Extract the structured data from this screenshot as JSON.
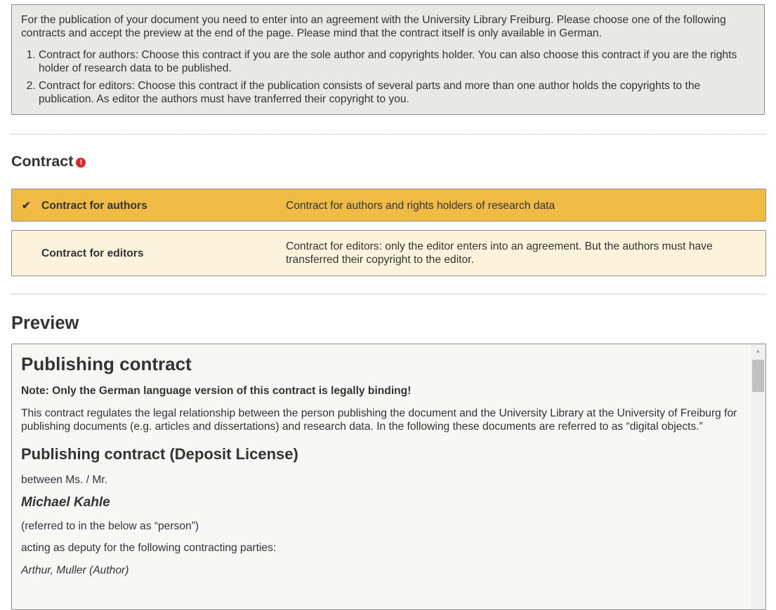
{
  "intro": {
    "text": "For the publication of your document you need to enter into an agreement with the University Library Freiburg. Please choose one of the following contracts and accept the preview at the end of the page. Please mind that the contract itself is only available in German.",
    "items": [
      "Contract for authors: Choose this contract if you are the sole author and copyrights holder. You can also choose this contract if you are the rights holder of research data to be published.",
      "Contract for editors: Choose this contract if the publication consists of several parts and more than one author holds the copyrights to the publication. As editor the authors must have tranferred their copyright to you."
    ]
  },
  "contract": {
    "heading": "Contract",
    "required_icon": "exclamation-icon",
    "options": [
      {
        "title": "Contract for authors",
        "description": "Contract for authors and rights holders of research data",
        "selected": true,
        "icon": "checkmark-icon",
        "color": "#f0bb44"
      },
      {
        "title": "Contract for editors",
        "description": "Contract for editors: only the editor enters into an agreement. But the authors must have transferred their copyright to the editor.",
        "selected": false,
        "color": "#fdf3dc"
      }
    ]
  },
  "preview": {
    "heading": "Preview",
    "doc": {
      "title": "Publishing contract",
      "note": "Note: Only the German language version of this contract is legally binding!",
      "intro": "This contract regulates the legal relationship between the person publishing the document and the University Library at the University of Freiburg for publishing documents (e.g. articles and dissertations) and research data. In the following these documents are referred to as “digital objects.”",
      "subtitle": "Publishing contract (Deposit License)",
      "between": "between Ms. / Mr.",
      "name": "Michael Kahle",
      "referred": "(referred to in the below as “person”)",
      "acting": "acting as deputy for the following contracting parties:",
      "parties": "Arthur, Muller (Author)"
    }
  }
}
